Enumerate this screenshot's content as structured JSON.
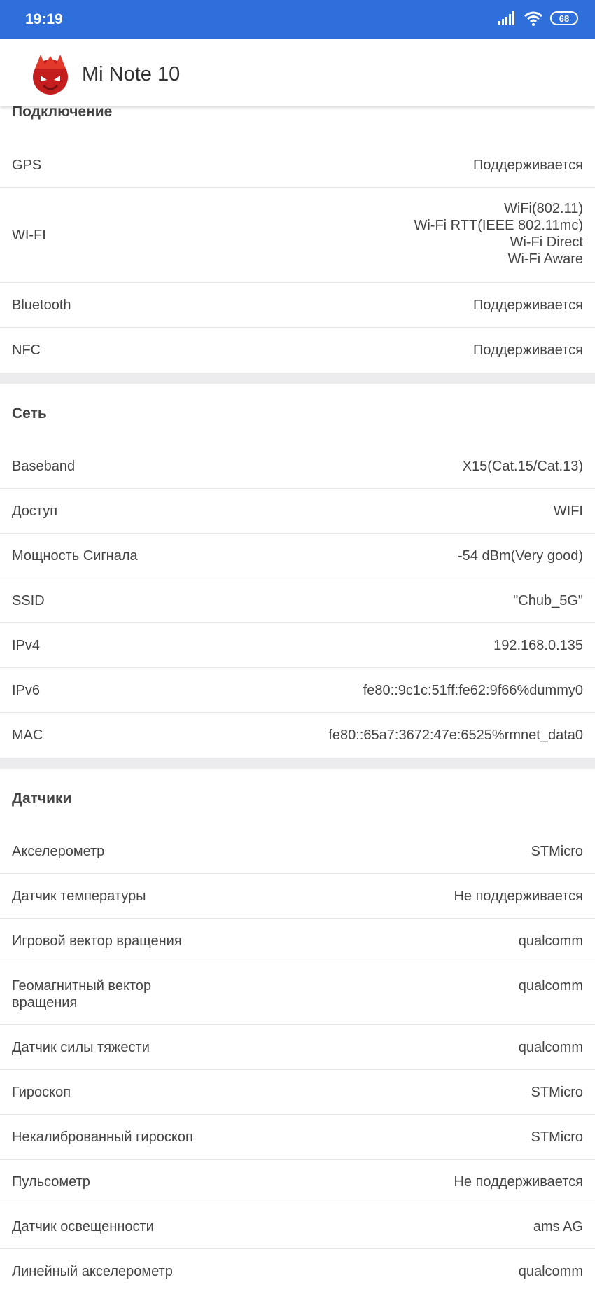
{
  "status_bar": {
    "time": "19:19",
    "battery": "68"
  },
  "app_bar": {
    "title": "Mi Note 10",
    "logo": "antutu-logo"
  },
  "sections": {
    "connection": {
      "title": "Подключение",
      "rows": [
        {
          "label": "GPS",
          "values": [
            "Поддерживается"
          ]
        },
        {
          "label": "WI-FI",
          "values": [
            "WiFi(802.11)",
            "Wi-Fi RTT(IEEE 802.11mc)",
            "Wi-Fi Direct",
            "Wi-Fi Aware"
          ]
        },
        {
          "label": "Bluetooth",
          "values": [
            "Поддерживается"
          ]
        },
        {
          "label": "NFC",
          "values": [
            "Поддерживается"
          ]
        }
      ]
    },
    "network": {
      "title": "Сеть",
      "rows": [
        {
          "label": "Baseband",
          "values": [
            "X15(Cat.15/Cat.13)"
          ]
        },
        {
          "label": "Доступ",
          "values": [
            "WIFI"
          ]
        },
        {
          "label": "Мощность Сигнала",
          "values": [
            "-54 dBm(Very good)"
          ]
        },
        {
          "label": "SSID",
          "values": [
            "\"Chub_5G\""
          ]
        },
        {
          "label": "IPv4",
          "values": [
            "192.168.0.135"
          ]
        },
        {
          "label": "IPv6",
          "values": [
            "fe80::9c1c:51ff:fe62:9f66%dummy0"
          ]
        },
        {
          "label": "MAC",
          "values": [
            "fe80::65a7:3672:47e:6525%rmnet_data0"
          ]
        }
      ]
    },
    "sensors": {
      "title": "Датчики",
      "rows": [
        {
          "label": "Акселерометр",
          "values": [
            "STMicro"
          ]
        },
        {
          "label": "Датчик температуры",
          "values": [
            "Не поддерживается"
          ]
        },
        {
          "label": "Игровой вектор вращения",
          "values": [
            "qualcomm"
          ]
        },
        {
          "label": "Геомагнитный вектор вращения",
          "values": [
            "qualcomm"
          ]
        },
        {
          "label": "Датчик силы тяжести",
          "values": [
            "qualcomm"
          ]
        },
        {
          "label": "Гироскоп",
          "values": [
            "STMicro"
          ]
        },
        {
          "label": "Некалиброванный гироскоп",
          "values": [
            "STMicro"
          ]
        },
        {
          "label": "Пульсометр",
          "values": [
            "Не поддерживается"
          ]
        },
        {
          "label": "Датчик освещенности",
          "values": [
            "ams AG"
          ]
        },
        {
          "label": "Линейный акселерометр",
          "values": [
            "qualcomm"
          ]
        }
      ]
    }
  }
}
